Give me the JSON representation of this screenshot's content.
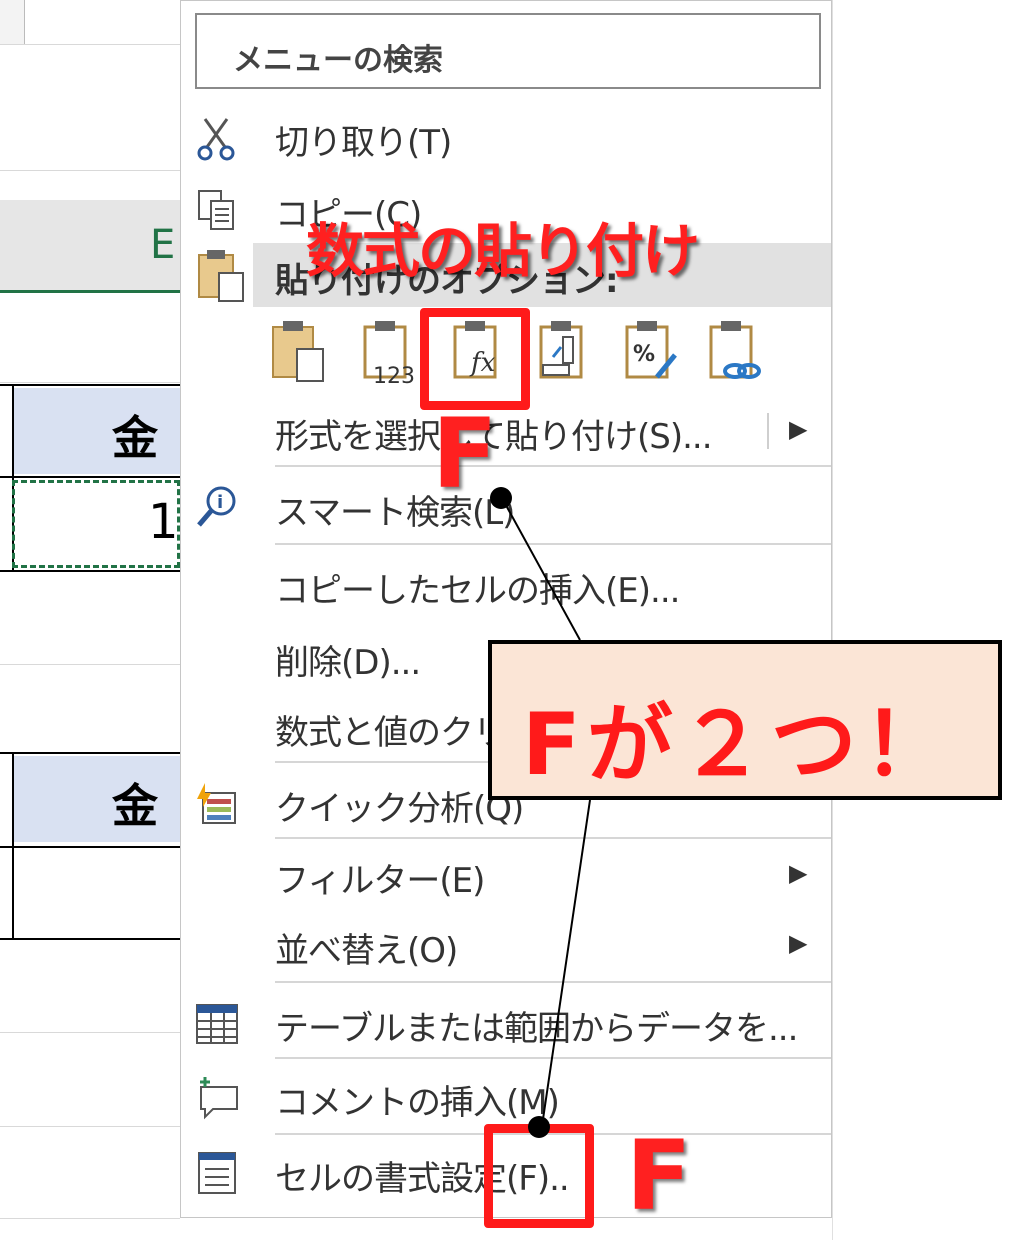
{
  "sheet": {
    "column_letter": "E",
    "header_text_1": "金",
    "header_text_2": "金",
    "value_cell": "1"
  },
  "menu": {
    "search_placeholder": "メニューの検索",
    "cut": "切り取り(T)",
    "copy": "コピー(C)",
    "paste_options": "貼り付けのオプション:",
    "paste_icon_values_label": "123",
    "paste_icon_formula_label": "fx",
    "paste_icon_percent_label": "%",
    "paste_special": "形式を選択して貼り付け(S)...",
    "smart_lookup": "スマート検索(L)",
    "insert_copied": "コピーしたセルの挿入(E)...",
    "delete": "削除(D)...",
    "clear": "数式と値のクリア(N)",
    "quick_analysis": "クイック分析(Q)",
    "filter": "フィルター(E)",
    "sort": "並べ替え(O)",
    "table_from_range": "テーブルまたは範囲からデータを...",
    "insert_comment": "コメントの挿入(M)",
    "format_cells": "セルの書式設定(F)..",
    "submenu_arrow": "▶"
  },
  "annotations": {
    "paste_formula_title": "数式の貼り付け",
    "f_label_top": "F",
    "f_label_bottom": "F",
    "callout": "Fが２つ！"
  },
  "colors": {
    "accent_red": "#ff1a1a",
    "excel_green": "#217346",
    "callout_bg": "#fbe5d6",
    "header_blue": "#d9e1f2"
  }
}
